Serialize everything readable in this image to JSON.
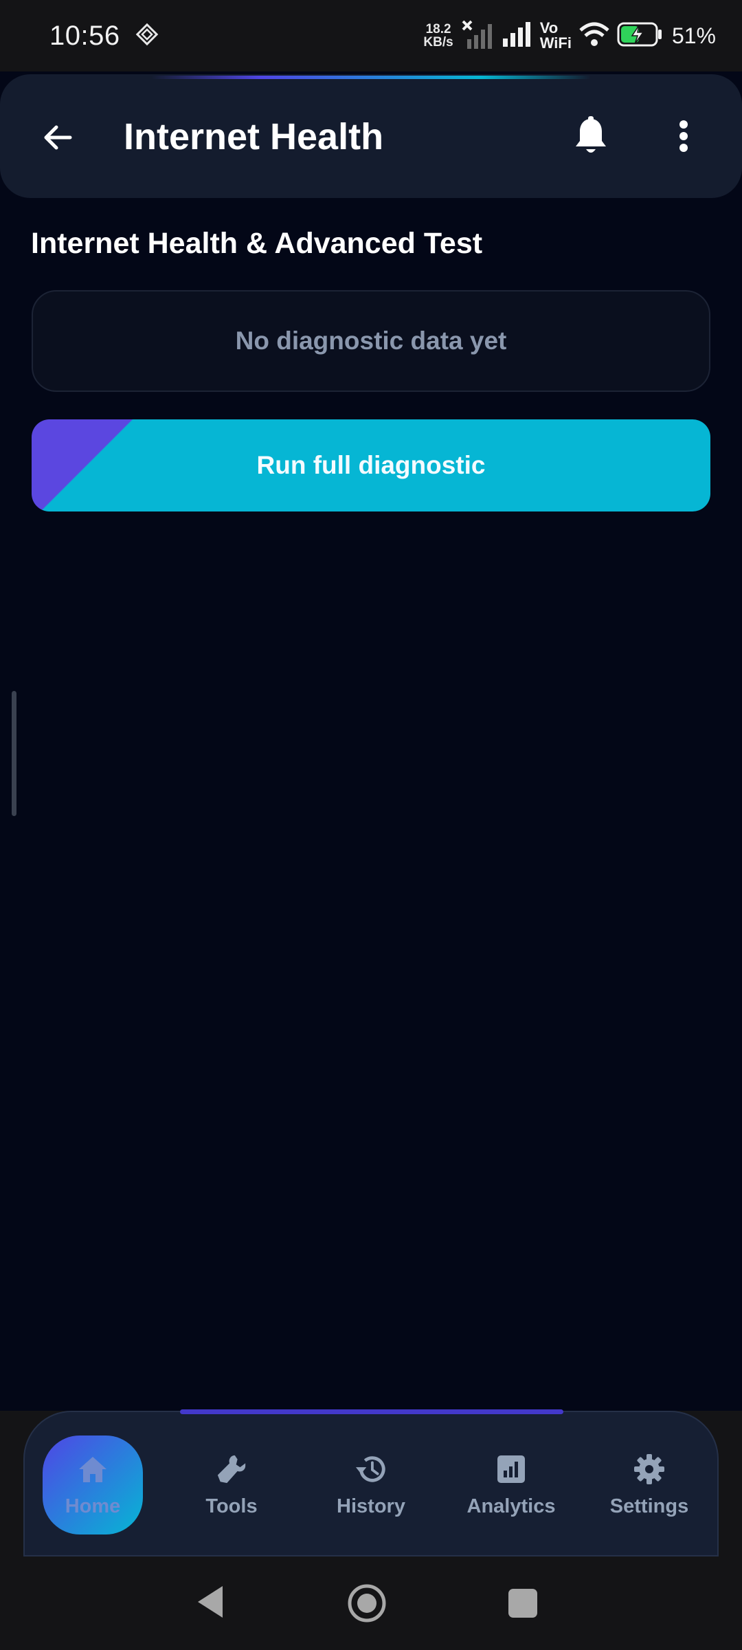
{
  "status_bar": {
    "time": "10:56",
    "net_speed_value": "18.2",
    "net_speed_unit": "KB/s",
    "vo_top": "Vo",
    "vo_bottom": "WiFi",
    "battery_percent": "51%"
  },
  "header": {
    "title": "Internet Health"
  },
  "main": {
    "section_title": "Internet Health & Advanced Test",
    "empty_state": "No diagnostic data yet",
    "run_button_label": "Run full diagnostic"
  },
  "bottom_nav": {
    "items": [
      {
        "label": "Home",
        "icon": "home-icon",
        "active": true
      },
      {
        "label": "Tools",
        "icon": "wrench-icon",
        "active": false
      },
      {
        "label": "History",
        "icon": "history-icon",
        "active": false
      },
      {
        "label": "Analytics",
        "icon": "analytics-icon",
        "active": false
      },
      {
        "label": "Settings",
        "icon": "gear-icon",
        "active": false
      }
    ]
  },
  "colors": {
    "background": "#030717",
    "header_bg": "#141c2e",
    "accent_cyan": "#06b6d4",
    "accent_indigo": "#4f46e5",
    "muted_text": "#94a3b8"
  }
}
